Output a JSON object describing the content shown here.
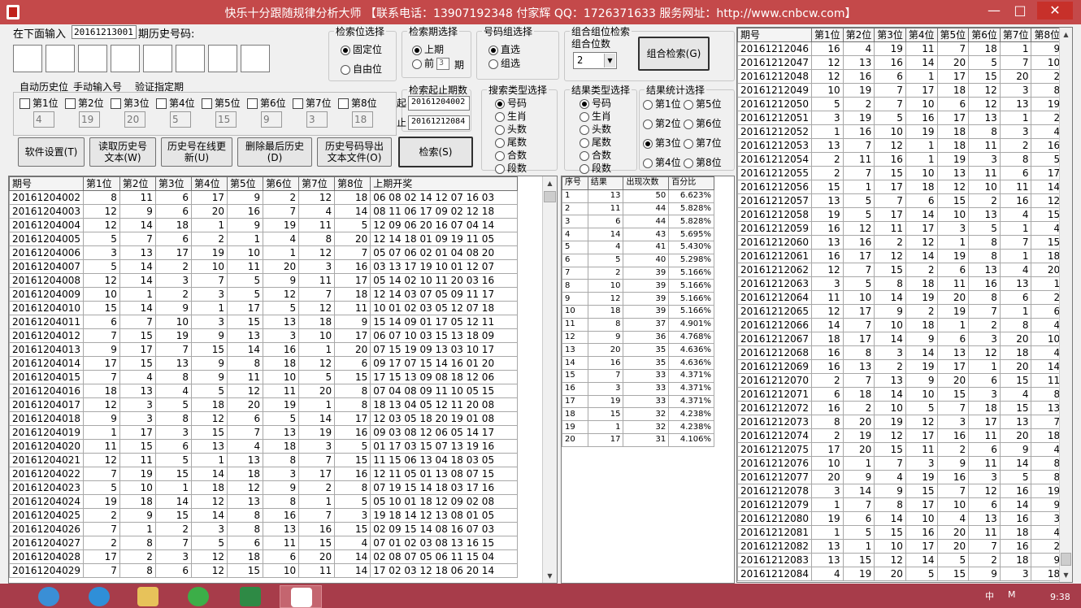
{
  "window": {
    "title": "快乐十分跟随规律分析大师 【联系电话：13907192348 付家辉 QQ：1726371633 服务网址：http://www.cnbcw.com】",
    "min": "—",
    "max": "□",
    "close": "✕"
  },
  "input": {
    "prompt_label": "在下面输入",
    "period_value": "20161213001",
    "history_label": "期历史号码:"
  },
  "tabs": [
    "自动历史位",
    "手动输入号",
    "验证指定期"
  ],
  "positions": {
    "labels": [
      "第1位",
      "第2位",
      "第3位",
      "第4位",
      "第5位",
      "第6位",
      "第7位",
      "第8位"
    ],
    "values": [
      "4",
      "19",
      "20",
      "5",
      "15",
      "9",
      "3",
      "18"
    ]
  },
  "buttons": {
    "settings": "软件设置(T)",
    "read_history": "读取历史号文本(W)",
    "update_online": "历史号在线更新(U)",
    "delete_last": "删除最后历史(D)",
    "export": "历史号码导出文本文件(O)",
    "search": "检索(S)",
    "combo_search": "组合检索(G)"
  },
  "pos_select": {
    "title": "检索位选择",
    "options": [
      "固定位",
      "自由位"
    ],
    "selected": 0
  },
  "period_select": {
    "title": "检索期选择",
    "option1": "上期",
    "option2_prefix": "前",
    "option2_value": "3",
    "option2_suffix": "期",
    "selected": 0
  },
  "group_select": {
    "title": "号码组选择",
    "options": [
      "直选",
      "组选"
    ],
    "selected": 0
  },
  "combo": {
    "title": "组合组位检索",
    "digits_label": "组合位数",
    "digits_value": "2"
  },
  "range": {
    "title": "检索起止期数",
    "start_label": "起",
    "start_value": "20161204002",
    "end_label": "止",
    "end_value": "20161212084"
  },
  "search_type": {
    "title": "搜索类型选择",
    "options": [
      "号码",
      "生肖",
      "头数",
      "尾数",
      "合数",
      "段数"
    ],
    "selected": 0
  },
  "result_type": {
    "title": "结果类型选择",
    "options": [
      "号码",
      "生肖",
      "头数",
      "尾数",
      "合数",
      "段数"
    ],
    "selected": 0
  },
  "stat_select": {
    "title": "结果统计选择",
    "options": [
      "第1位",
      "第5位",
      "第2位",
      "第6位",
      "第3位",
      "第7位",
      "第4位",
      "第8位"
    ],
    "selected": 4
  },
  "history_table": {
    "headers": [
      "期号",
      "第1位",
      "第2位",
      "第3位",
      "第4位",
      "第5位",
      "第6位",
      "第7位",
      "第8位",
      "上期开奖"
    ],
    "rows": [
      [
        "20161204002",
        "8",
        "11",
        "6",
        "17",
        "9",
        "2",
        "12",
        "18",
        "06 08 02 14 12 07 16 03"
      ],
      [
        "20161204003",
        "12",
        "9",
        "6",
        "20",
        "16",
        "7",
        "4",
        "14",
        "08 11 06 17 09 02 12 18"
      ],
      [
        "20161204004",
        "12",
        "14",
        "18",
        "1",
        "9",
        "19",
        "11",
        "5",
        "12 09 06 20 16 07 04 14"
      ],
      [
        "20161204005",
        "5",
        "7",
        "6",
        "2",
        "1",
        "4",
        "8",
        "20",
        "12 14 18 01 09 19 11 05"
      ],
      [
        "20161204006",
        "3",
        "13",
        "17",
        "19",
        "10",
        "1",
        "12",
        "7",
        "05 07 06 02 01 04 08 20"
      ],
      [
        "20161204007",
        "5",
        "14",
        "2",
        "10",
        "11",
        "20",
        "3",
        "16",
        "03 13 17 19 10 01 12 07"
      ],
      [
        "20161204008",
        "12",
        "14",
        "3",
        "7",
        "5",
        "9",
        "11",
        "17",
        "05 14 02 10 11 20 03 16"
      ],
      [
        "20161204009",
        "10",
        "1",
        "2",
        "3",
        "5",
        "12",
        "7",
        "18",
        "12 14 03 07 05 09 11 17"
      ],
      [
        "20161204010",
        "15",
        "14",
        "9",
        "1",
        "17",
        "5",
        "12",
        "11",
        "10 01 02 03 05 12 07 18"
      ],
      [
        "20161204011",
        "6",
        "7",
        "10",
        "3",
        "15",
        "13",
        "18",
        "9",
        "15 14 09 01 17 05 12 11"
      ],
      [
        "20161204012",
        "7",
        "15",
        "19",
        "9",
        "13",
        "3",
        "10",
        "17",
        "06 07 10 03 15 13 18 09"
      ],
      [
        "20161204013",
        "9",
        "17",
        "7",
        "15",
        "14",
        "16",
        "1",
        "20",
        "07 15 19 09 13 03 10 17"
      ],
      [
        "20161204014",
        "17",
        "15",
        "13",
        "9",
        "8",
        "18",
        "12",
        "6",
        "09 17 07 15 14 16 01 20"
      ],
      [
        "20161204015",
        "7",
        "4",
        "8",
        "9",
        "11",
        "10",
        "5",
        "15",
        "17 15 13 09 08 18 12 06"
      ],
      [
        "20161204016",
        "18",
        "13",
        "4",
        "5",
        "12",
        "11",
        "20",
        "8",
        "07 04 08 09 11 10 05 15"
      ],
      [
        "20161204017",
        "12",
        "3",
        "5",
        "18",
        "20",
        "19",
        "1",
        "8",
        "18 13 04 05 12 11 20 08"
      ],
      [
        "20161204018",
        "9",
        "3",
        "8",
        "12",
        "6",
        "5",
        "14",
        "17",
        "12 03 05 18 20 19 01 08"
      ],
      [
        "20161204019",
        "1",
        "17",
        "3",
        "15",
        "7",
        "13",
        "19",
        "16",
        "09 03 08 12 06 05 14 17"
      ],
      [
        "20161204020",
        "11",
        "15",
        "6",
        "13",
        "4",
        "18",
        "3",
        "5",
        "01 17 03 15 07 13 19 16"
      ],
      [
        "20161204021",
        "12",
        "11",
        "5",
        "1",
        "13",
        "8",
        "7",
        "15",
        "11 15 06 13 04 18 03 05"
      ],
      [
        "20161204022",
        "7",
        "19",
        "15",
        "14",
        "18",
        "3",
        "17",
        "16",
        "12 11 05 01 13 08 07 15"
      ],
      [
        "20161204023",
        "5",
        "10",
        "1",
        "18",
        "12",
        "9",
        "2",
        "8",
        "07 19 15 14 18 03 17 16"
      ],
      [
        "20161204024",
        "19",
        "18",
        "14",
        "12",
        "13",
        "8",
        "1",
        "5",
        "05 10 01 18 12 09 02 08"
      ],
      [
        "20161204025",
        "2",
        "9",
        "15",
        "14",
        "8",
        "16",
        "7",
        "3",
        "19 18 14 12 13 08 01 05"
      ],
      [
        "20161204026",
        "7",
        "1",
        "2",
        "3",
        "8",
        "13",
        "16",
        "15",
        "02 09 15 14 08 16 07 03"
      ],
      [
        "20161204027",
        "2",
        "8",
        "7",
        "5",
        "6",
        "11",
        "15",
        "4",
        "07 01 02 03 08 13 16 15"
      ],
      [
        "20161204028",
        "17",
        "2",
        "3",
        "12",
        "18",
        "6",
        "20",
        "14",
        "02 08 07 05 06 11 15 04"
      ],
      [
        "20161204029",
        "7",
        "8",
        "6",
        "12",
        "15",
        "10",
        "11",
        "14",
        "17 02 03 12 18 06 20 14"
      ]
    ]
  },
  "result_table": {
    "headers": [
      "序号",
      "结果",
      "出现次数",
      "百分比"
    ],
    "rows": [
      [
        "1",
        "13",
        "50",
        "6.623%"
      ],
      [
        "2",
        "11",
        "44",
        "5.828%"
      ],
      [
        "3",
        "6",
        "44",
        "5.828%"
      ],
      [
        "4",
        "14",
        "43",
        "5.695%"
      ],
      [
        "5",
        "4",
        "41",
        "5.430%"
      ],
      [
        "6",
        "5",
        "40",
        "5.298%"
      ],
      [
        "7",
        "2",
        "39",
        "5.166%"
      ],
      [
        "8",
        "10",
        "39",
        "5.166%"
      ],
      [
        "9",
        "12",
        "39",
        "5.166%"
      ],
      [
        "10",
        "18",
        "39",
        "5.166%"
      ],
      [
        "11",
        "8",
        "37",
        "4.901%"
      ],
      [
        "12",
        "9",
        "36",
        "4.768%"
      ],
      [
        "13",
        "20",
        "35",
        "4.636%"
      ],
      [
        "14",
        "16",
        "35",
        "4.636%"
      ],
      [
        "15",
        "7",
        "33",
        "4.371%"
      ],
      [
        "16",
        "3",
        "33",
        "4.371%"
      ],
      [
        "17",
        "19",
        "33",
        "4.371%"
      ],
      [
        "18",
        "15",
        "32",
        "4.238%"
      ],
      [
        "19",
        "1",
        "32",
        "4.238%"
      ],
      [
        "20",
        "17",
        "31",
        "4.106%"
      ]
    ]
  },
  "right_table": {
    "headers": [
      "期号",
      "第1位",
      "第2位",
      "第3位",
      "第4位",
      "第5位",
      "第6位",
      "第7位",
      "第8位"
    ],
    "rows": [
      [
        "20161212046",
        "16",
        "4",
        "19",
        "11",
        "7",
        "18",
        "1",
        "9"
      ],
      [
        "20161212047",
        "12",
        "13",
        "16",
        "14",
        "20",
        "5",
        "7",
        "10"
      ],
      [
        "20161212048",
        "12",
        "16",
        "6",
        "1",
        "17",
        "15",
        "20",
        "2"
      ],
      [
        "20161212049",
        "10",
        "19",
        "7",
        "17",
        "18",
        "12",
        "3",
        "8"
      ],
      [
        "20161212050",
        "5",
        "2",
        "7",
        "10",
        "6",
        "12",
        "13",
        "19"
      ],
      [
        "20161212051",
        "3",
        "19",
        "5",
        "16",
        "17",
        "13",
        "1",
        "2"
      ],
      [
        "20161212052",
        "1",
        "16",
        "10",
        "19",
        "18",
        "8",
        "3",
        "4"
      ],
      [
        "20161212053",
        "13",
        "7",
        "12",
        "1",
        "18",
        "11",
        "2",
        "16"
      ],
      [
        "20161212054",
        "2",
        "11",
        "16",
        "1",
        "19",
        "3",
        "8",
        "5"
      ],
      [
        "20161212055",
        "2",
        "7",
        "15",
        "10",
        "13",
        "11",
        "6",
        "17"
      ],
      [
        "20161212056",
        "15",
        "1",
        "17",
        "18",
        "12",
        "10",
        "11",
        "14"
      ],
      [
        "20161212057",
        "13",
        "5",
        "7",
        "6",
        "15",
        "2",
        "16",
        "12"
      ],
      [
        "20161212058",
        "19",
        "5",
        "17",
        "14",
        "10",
        "13",
        "4",
        "15"
      ],
      [
        "20161212059",
        "16",
        "12",
        "11",
        "17",
        "3",
        "5",
        "1",
        "4"
      ],
      [
        "20161212060",
        "13",
        "16",
        "2",
        "12",
        "1",
        "8",
        "7",
        "15"
      ],
      [
        "20161212061",
        "16",
        "17",
        "12",
        "14",
        "19",
        "8",
        "1",
        "18"
      ],
      [
        "20161212062",
        "12",
        "7",
        "15",
        "2",
        "6",
        "13",
        "4",
        "20"
      ],
      [
        "20161212063",
        "3",
        "5",
        "8",
        "18",
        "11",
        "16",
        "13",
        "1"
      ],
      [
        "20161212064",
        "11",
        "10",
        "14",
        "19",
        "20",
        "8",
        "6",
        "2"
      ],
      [
        "20161212065",
        "12",
        "17",
        "9",
        "2",
        "19",
        "7",
        "1",
        "6"
      ],
      [
        "20161212066",
        "14",
        "7",
        "10",
        "18",
        "1",
        "2",
        "8",
        "4"
      ],
      [
        "20161212067",
        "18",
        "17",
        "14",
        "9",
        "6",
        "3",
        "20",
        "10"
      ],
      [
        "20161212068",
        "16",
        "8",
        "3",
        "14",
        "13",
        "12",
        "18",
        "4"
      ],
      [
        "20161212069",
        "16",
        "13",
        "2",
        "19",
        "17",
        "1",
        "20",
        "14"
      ],
      [
        "20161212070",
        "2",
        "7",
        "13",
        "9",
        "20",
        "6",
        "15",
        "11"
      ],
      [
        "20161212071",
        "6",
        "18",
        "14",
        "10",
        "15",
        "3",
        "4",
        "8"
      ],
      [
        "20161212072",
        "16",
        "2",
        "10",
        "5",
        "7",
        "18",
        "15",
        "13"
      ],
      [
        "20161212073",
        "8",
        "20",
        "19",
        "12",
        "3",
        "17",
        "13",
        "7"
      ],
      [
        "20161212074",
        "2",
        "19",
        "12",
        "17",
        "16",
        "11",
        "20",
        "18"
      ],
      [
        "20161212075",
        "17",
        "20",
        "15",
        "11",
        "2",
        "6",
        "9",
        "4"
      ],
      [
        "20161212076",
        "10",
        "1",
        "7",
        "3",
        "9",
        "11",
        "14",
        "8"
      ],
      [
        "20161212077",
        "20",
        "9",
        "4",
        "19",
        "16",
        "3",
        "5",
        "8"
      ],
      [
        "20161212078",
        "3",
        "14",
        "9",
        "15",
        "7",
        "12",
        "16",
        "19"
      ],
      [
        "20161212079",
        "1",
        "7",
        "8",
        "17",
        "10",
        "6",
        "14",
        "9"
      ],
      [
        "20161212080",
        "19",
        "6",
        "14",
        "10",
        "4",
        "13",
        "16",
        "3"
      ],
      [
        "20161212081",
        "1",
        "5",
        "15",
        "16",
        "20",
        "11",
        "18",
        "4"
      ],
      [
        "20161212082",
        "13",
        "1",
        "10",
        "17",
        "20",
        "7",
        "16",
        "2"
      ],
      [
        "20161212083",
        "13",
        "15",
        "12",
        "14",
        "5",
        "2",
        "18",
        "9"
      ],
      [
        "20161212084",
        "4",
        "19",
        "20",
        "5",
        "15",
        "9",
        "3",
        "18"
      ]
    ]
  },
  "taskbar": {
    "clock": "9:38",
    "ime": "中",
    "lang": "M"
  }
}
